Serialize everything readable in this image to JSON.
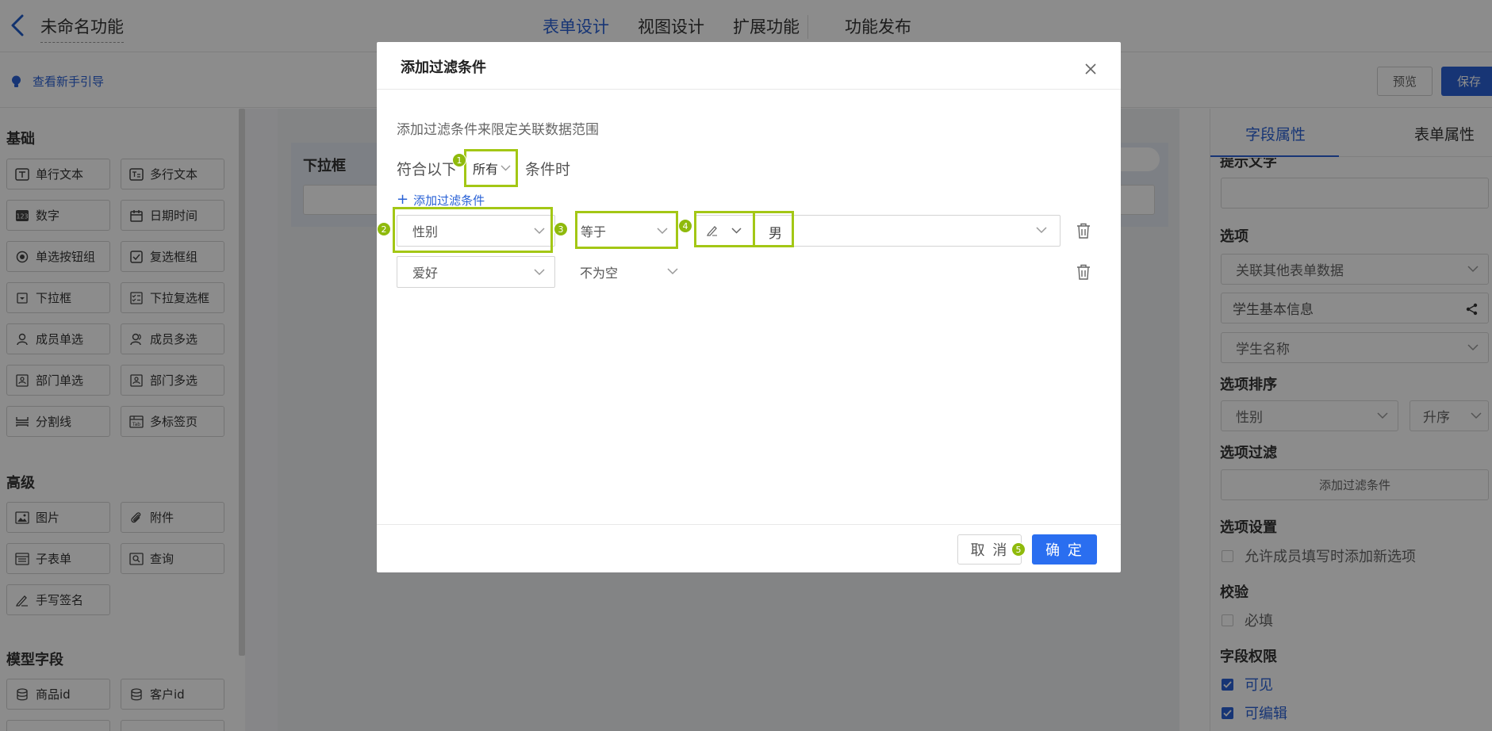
{
  "header": {
    "title": "未命名功能",
    "tabs": [
      {
        "label": "表单设计",
        "active": true
      },
      {
        "label": "视图设计",
        "active": false
      },
      {
        "label": "扩展功能",
        "active": false
      },
      {
        "label": "功能发布",
        "active": false
      }
    ],
    "accent_color": "#2a62d6"
  },
  "subbar": {
    "guide_label": "查看新手引导",
    "preview_label": "预览",
    "save_label": "保存"
  },
  "palette": {
    "groups": [
      {
        "title": "基础",
        "items": [
          {
            "label": "单行文本",
            "icon": "single-line-text-icon"
          },
          {
            "label": "多行文本",
            "icon": "multi-line-text-icon"
          },
          {
            "label": "数字",
            "icon": "number-icon"
          },
          {
            "label": "日期时间",
            "icon": "calendar-icon"
          },
          {
            "label": "单选按钮组",
            "icon": "radio-icon"
          },
          {
            "label": "复选框组",
            "icon": "checkbox-icon"
          },
          {
            "label": "下拉框",
            "icon": "dropdown-icon"
          },
          {
            "label": "下拉复选框",
            "icon": "dropdown-multi-icon"
          },
          {
            "label": "成员单选",
            "icon": "user-icon"
          },
          {
            "label": "成员多选",
            "icon": "users-icon"
          },
          {
            "label": "部门单选",
            "icon": "department-icon"
          },
          {
            "label": "部门多选",
            "icon": "departments-icon"
          },
          {
            "label": "分割线",
            "icon": "divider-icon"
          },
          {
            "label": "多标签页",
            "icon": "tabs-icon"
          }
        ]
      },
      {
        "title": "高级",
        "items": [
          {
            "label": "图片",
            "icon": "image-icon"
          },
          {
            "label": "附件",
            "icon": "attachment-icon"
          },
          {
            "label": "子表单",
            "icon": "subform-icon"
          },
          {
            "label": "查询",
            "icon": "query-icon"
          },
          {
            "label": "手写签名",
            "icon": "signature-icon"
          }
        ]
      },
      {
        "title": "模型字段",
        "items": [
          {
            "label": "商品id",
            "icon": "database-icon"
          },
          {
            "label": "客户id",
            "icon": "database-icon"
          }
        ]
      }
    ]
  },
  "canvas": {
    "field_label": "下拉框"
  },
  "right_panel": {
    "tabs": [
      "字段属性",
      "表单属性"
    ],
    "placeholder_label": "提示文字",
    "options_label": "选项",
    "options_source": "关联其他表单数据",
    "linked_form": "学生基本信息",
    "linked_field": "学生名称",
    "sort_label": "选项排序",
    "sort_field": "性别",
    "sort_order": "升序",
    "filter_label": "选项过滤",
    "filter_button": "添加过滤条件",
    "settings_label": "选项设置",
    "allow_new_option": "允许成员填写时添加新选项",
    "validation_label": "校验",
    "required": "必填",
    "permission_label": "字段权限",
    "visible": "可见",
    "editable": "可编辑"
  },
  "modal": {
    "title": "添加过滤条件",
    "description": "添加过滤条件来限定关联数据范围",
    "match_prefix": "符合以下",
    "match_value": "所有",
    "match_suffix": "条件时",
    "add_condition": "添加过滤条件",
    "conditions": [
      {
        "field": "性别",
        "operator": "等于",
        "value": "男"
      },
      {
        "field": "爱好",
        "operator": "不为空",
        "value": ""
      }
    ],
    "cancel_label": "取 消",
    "ok_label": "确 定",
    "callouts": [
      "1",
      "2",
      "3",
      "4",
      "5"
    ],
    "highlight_color": "#a3c715"
  }
}
